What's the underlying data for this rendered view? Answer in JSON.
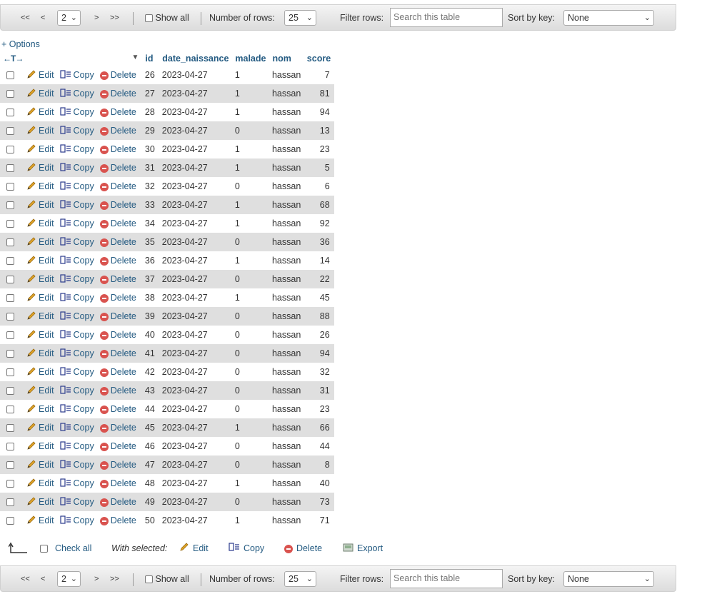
{
  "nav": {
    "first": "<<",
    "prev": "<",
    "page": "2",
    "next": ">",
    "last": ">>",
    "show_all": "Show all",
    "rows_label": "Number of rows:",
    "rows_value": "25",
    "filter_label": "Filter rows:",
    "filter_placeholder": "Search this table",
    "sort_label": "Sort by key:",
    "sort_value": "None"
  },
  "options": "+ Options",
  "header": {
    "arrows": "←T→",
    "id": "id",
    "date": "date_naissance",
    "malade": "malade",
    "nom": "nom",
    "score": "score"
  },
  "actions": {
    "edit": "Edit",
    "copy": "Copy",
    "delete": "Delete"
  },
  "rows": [
    {
      "id": "26",
      "date": "2023-04-27",
      "malade": "1",
      "nom": "hassan",
      "score": "7"
    },
    {
      "id": "27",
      "date": "2023-04-27",
      "malade": "1",
      "nom": "hassan",
      "score": "81"
    },
    {
      "id": "28",
      "date": "2023-04-27",
      "malade": "1",
      "nom": "hassan",
      "score": "94"
    },
    {
      "id": "29",
      "date": "2023-04-27",
      "malade": "0",
      "nom": "hassan",
      "score": "13"
    },
    {
      "id": "30",
      "date": "2023-04-27",
      "malade": "1",
      "nom": "hassan",
      "score": "23"
    },
    {
      "id": "31",
      "date": "2023-04-27",
      "malade": "1",
      "nom": "hassan",
      "score": "5"
    },
    {
      "id": "32",
      "date": "2023-04-27",
      "malade": "0",
      "nom": "hassan",
      "score": "6"
    },
    {
      "id": "33",
      "date": "2023-04-27",
      "malade": "1",
      "nom": "hassan",
      "score": "68"
    },
    {
      "id": "34",
      "date": "2023-04-27",
      "malade": "1",
      "nom": "hassan",
      "score": "92"
    },
    {
      "id": "35",
      "date": "2023-04-27",
      "malade": "0",
      "nom": "hassan",
      "score": "36"
    },
    {
      "id": "36",
      "date": "2023-04-27",
      "malade": "1",
      "nom": "hassan",
      "score": "14"
    },
    {
      "id": "37",
      "date": "2023-04-27",
      "malade": "0",
      "nom": "hassan",
      "score": "22"
    },
    {
      "id": "38",
      "date": "2023-04-27",
      "malade": "1",
      "nom": "hassan",
      "score": "45"
    },
    {
      "id": "39",
      "date": "2023-04-27",
      "malade": "0",
      "nom": "hassan",
      "score": "88"
    },
    {
      "id": "40",
      "date": "2023-04-27",
      "malade": "0",
      "nom": "hassan",
      "score": "26"
    },
    {
      "id": "41",
      "date": "2023-04-27",
      "malade": "0",
      "nom": "hassan",
      "score": "94"
    },
    {
      "id": "42",
      "date": "2023-04-27",
      "malade": "0",
      "nom": "hassan",
      "score": "32"
    },
    {
      "id": "43",
      "date": "2023-04-27",
      "malade": "0",
      "nom": "hassan",
      "score": "31"
    },
    {
      "id": "44",
      "date": "2023-04-27",
      "malade": "0",
      "nom": "hassan",
      "score": "23"
    },
    {
      "id": "45",
      "date": "2023-04-27",
      "malade": "1",
      "nom": "hassan",
      "score": "66"
    },
    {
      "id": "46",
      "date": "2023-04-27",
      "malade": "0",
      "nom": "hassan",
      "score": "44"
    },
    {
      "id": "47",
      "date": "2023-04-27",
      "malade": "0",
      "nom": "hassan",
      "score": "8"
    },
    {
      "id": "48",
      "date": "2023-04-27",
      "malade": "1",
      "nom": "hassan",
      "score": "40"
    },
    {
      "id": "49",
      "date": "2023-04-27",
      "malade": "0",
      "nom": "hassan",
      "score": "73"
    },
    {
      "id": "50",
      "date": "2023-04-27",
      "malade": "1",
      "nom": "hassan",
      "score": "71"
    }
  ],
  "footer": {
    "check_all": "Check all",
    "with_selected": "With selected:",
    "edit": "Edit",
    "copy": "Copy",
    "delete": "Delete",
    "export": "Export"
  },
  "colors": {
    "link": "#235a81",
    "row_alt": "#dfdfdf",
    "delete_icon": "#d9534f"
  }
}
